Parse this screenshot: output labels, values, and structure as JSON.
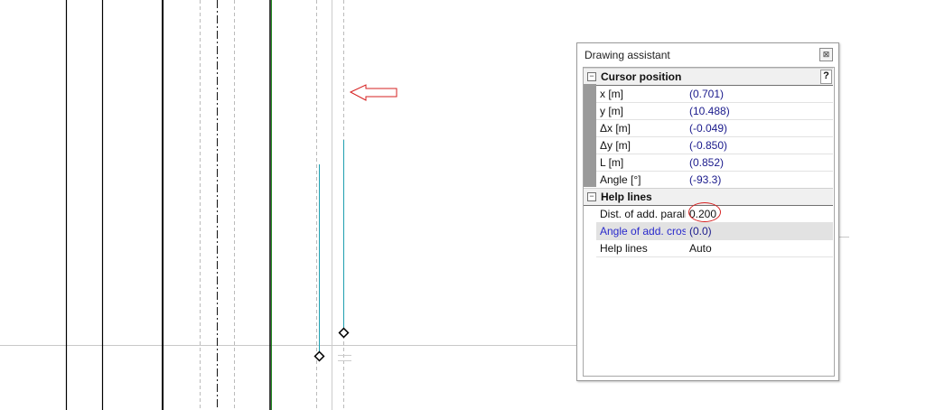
{
  "panel": {
    "title": "Drawing assistant",
    "close_glyph": "⊠"
  },
  "sections": {
    "cursor": {
      "title": "Cursor position",
      "toggle": "−",
      "help": "?",
      "rows": [
        {
          "name": "x [m]",
          "value": "(0.701)"
        },
        {
          "name": "y [m]",
          "value": "(10.488)"
        },
        {
          "name": "Δx [m]",
          "value": "(-0.049)"
        },
        {
          "name": "Δy [m]",
          "value": "(-0.850)"
        },
        {
          "name": "L [m]",
          "value": "(0.852)"
        },
        {
          "name": "Angle [°]",
          "value": "(-93.3)"
        }
      ]
    },
    "help_lines": {
      "title": "Help lines",
      "toggle": "−",
      "rows": [
        {
          "name": "Dist. of add. parallel",
          "value": "0.200"
        },
        {
          "name": "Angle of add. cross",
          "value": "(0.0)"
        },
        {
          "name": "Help lines",
          "value": "Auto"
        }
      ]
    }
  },
  "colors": {
    "accent_red": "#d62020",
    "value_blue": "#1a1a8c",
    "selected_name_blue": "#2a2acc",
    "green_line": "#1f8a1f",
    "teal_line": "#1f9fb0"
  },
  "icons": {
    "arrow": "left-arrow-icon",
    "node": "diamond-node-icon"
  }
}
